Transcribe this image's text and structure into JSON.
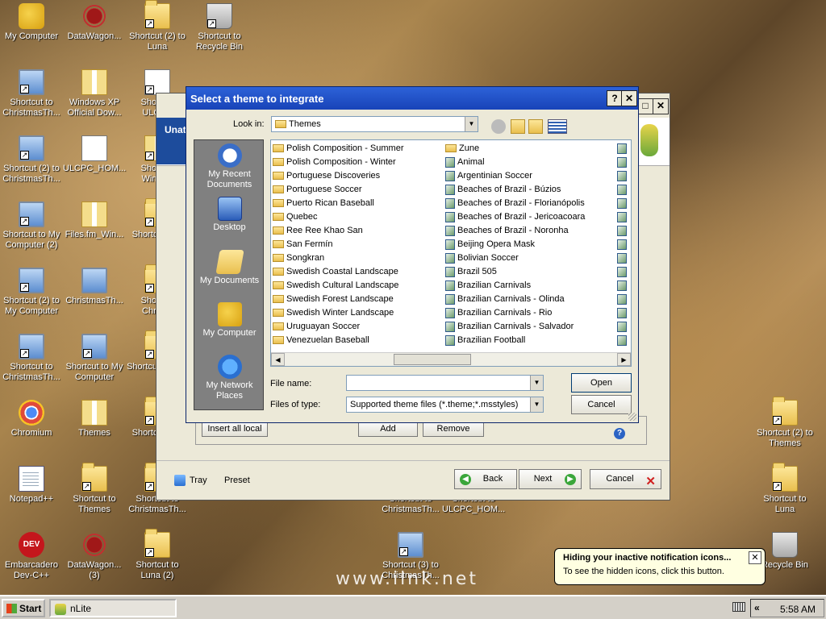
{
  "desktop": {
    "icons": [
      {
        "id": "my-computer",
        "label": "My Computer",
        "icon": "puzzle-icon"
      },
      {
        "id": "datawagon-1",
        "label": "DataWagon...",
        "icon": "web-icon"
      },
      {
        "id": "shortcut-luna-2",
        "label": "Shortcut (2) to Luna",
        "icon": "folder-icon"
      },
      {
        "id": "shortcut-recycle",
        "label": "Shortcut to Recycle Bin",
        "icon": "recycle-bin-icon"
      },
      {
        "id": "shortcut-christmas-1",
        "label": "Shortcut to ChristmasTh...",
        "icon": "pc-icon"
      },
      {
        "id": "winxp-official",
        "label": "Windows XP Official Dow...",
        "icon": "zip-icon"
      },
      {
        "id": "shortcut-ulcpc",
        "label": "Shortcut ULCPC",
        "icon": "doc-icon"
      },
      {
        "id": "shortcut-christmas-2",
        "label": "Shortcut (2) to ChristmasTh...",
        "icon": "pc-icon"
      },
      {
        "id": "ulcpc-hom",
        "label": "ULCPC_HOM...",
        "icon": "doc-icon"
      },
      {
        "id": "shortcut-window",
        "label": "Shortcut Window",
        "icon": "zip-icon"
      },
      {
        "id": "shortcut-mycomp-2",
        "label": "Shortcut to My Computer (2)",
        "icon": "pc-icon"
      },
      {
        "id": "files-fm",
        "label": "Files.fm_Win...",
        "icon": "zip-icon"
      },
      {
        "id": "shortcut-the",
        "label": "Shortcut The",
        "icon": "folder-icon"
      },
      {
        "id": "shortcut2-mycomp",
        "label": "Shortcut (2) to My Computer",
        "icon": "pc-icon"
      },
      {
        "id": "christmasth",
        "label": "ChristmasTh...",
        "icon": "pc-icon"
      },
      {
        "id": "shortcut-christm",
        "label": "Shortcut Christm",
        "icon": "folder-icon"
      },
      {
        "id": "shortcut-christmas-3",
        "label": "Shortcut to ChristmasTh...",
        "icon": "pc-icon"
      },
      {
        "id": "shortcut-mycomp",
        "label": "Shortcut to My Computer",
        "icon": "pc-icon"
      },
      {
        "id": "shortcut-myco",
        "label": "Shortcut My Co",
        "icon": "folder-icon"
      },
      {
        "id": "chromium",
        "label": "Chromium",
        "icon": "chromium-icon"
      },
      {
        "id": "themes",
        "label": "Themes",
        "icon": "zip-icon"
      },
      {
        "id": "shortcut-the-2",
        "label": "Shortcut The",
        "icon": "folder-icon"
      },
      {
        "id": "notepadpp",
        "label": "Notepad++",
        "icon": "notepad-icon"
      },
      {
        "id": "shortcut-themes",
        "label": "Shortcut to Themes",
        "icon": "folder-icon"
      },
      {
        "id": "shortcut-christmas-4",
        "label": "Shortcut to ChristmasTh...",
        "icon": "folder-icon"
      },
      {
        "id": "embarcadero",
        "label": "Embarcadero Dev-C++",
        "icon": "devcpp-icon"
      },
      {
        "id": "datawagon-3",
        "label": "DataWagon... (3)",
        "icon": "web-icon"
      },
      {
        "id": "shortcut-luna-2b",
        "label": "Shortcut to Luna (2)",
        "icon": "folder-icon"
      },
      {
        "id": "shortcut-christmas-mid",
        "label": "Shortcut to ChristmasTh...",
        "icon": "folder-icon"
      },
      {
        "id": "shortcut-ulcpc-hom",
        "label": "Shortcut to ULCPC_HOM...",
        "icon": "folder-icon"
      },
      {
        "id": "shortcut3-christmas",
        "label": "Shortcut (3) to ChristmasTh...",
        "icon": "pc-icon"
      },
      {
        "id": "shortcut2-themes",
        "label": "Shortcut (2) to Themes",
        "icon": "folder-icon"
      },
      {
        "id": "shortcut-luna",
        "label": "Shortcut to Luna",
        "icon": "folder-icon"
      },
      {
        "id": "recycle-bin",
        "label": "Recycle Bin",
        "icon": "recycle-bin-icon"
      }
    ],
    "watermark": "www.ilnk.net"
  },
  "nlite": {
    "header_text": "Unat",
    "buttons": {
      "insert_all_local": "Insert all local",
      "add": "Add",
      "remove": "Remove",
      "tray": "Tray",
      "preset": "Preset",
      "back": "Back",
      "next": "Next",
      "cancel": "Cancel"
    }
  },
  "dialog": {
    "title": "Select a theme to integrate",
    "help_btn": "?",
    "close_btn": "✕",
    "look_in_label": "Look in:",
    "look_in_value": "Themes",
    "places": [
      {
        "label": "My Recent Documents",
        "icon": "recent-documents-icon"
      },
      {
        "label": "Desktop",
        "icon": "desktop-icon"
      },
      {
        "label": "My Documents",
        "icon": "my-documents-icon"
      },
      {
        "label": "My Computer",
        "icon": "my-computer-icon"
      },
      {
        "label": "My Network Places",
        "icon": "network-places-icon"
      }
    ],
    "files_col1": [
      "Polish Composition - Summer",
      "Polish Composition - Winter",
      "Portuguese Discoveries",
      "Portuguese Soccer",
      "Puerto Rican Baseball",
      "Quebec",
      "Ree Ree Khao San",
      "San Fermín",
      "Songkran",
      "Swedish Coastal Landscape",
      "Swedish Cultural Landscape",
      "Swedish Forest Landscape",
      "Swedish Winter Landscape",
      "Uruguayan Soccer",
      "Venezuelan Baseball"
    ],
    "files_col2": [
      {
        "name": "Zune",
        "type": "folder"
      },
      {
        "name": "Animal",
        "type": "theme"
      },
      {
        "name": "Argentinian Soccer",
        "type": "theme"
      },
      {
        "name": "Beaches of Brazil - Búzios",
        "type": "theme"
      },
      {
        "name": "Beaches of Brazil - Florianópolis",
        "type": "theme"
      },
      {
        "name": "Beaches of Brazil - Jericoacoara",
        "type": "theme"
      },
      {
        "name": "Beaches of Brazil - Noronha",
        "type": "theme"
      },
      {
        "name": "Beijing Opera Mask",
        "type": "theme"
      },
      {
        "name": "Bolivian Soccer",
        "type": "theme"
      },
      {
        "name": "Brazil 505",
        "type": "theme"
      },
      {
        "name": "Brazilian Carnivals",
        "type": "theme"
      },
      {
        "name": "Brazilian Carnivals - Olinda",
        "type": "theme"
      },
      {
        "name": "Brazilian Carnivals - Rio",
        "type": "theme"
      },
      {
        "name": "Brazilian Carnivals - Salvador",
        "type": "theme"
      },
      {
        "name": "Brazilian Football",
        "type": "theme"
      }
    ],
    "file_name_label": "File name:",
    "file_name_value": "",
    "files_of_type_label": "Files of type:",
    "files_of_type_value": "Supported theme files (*.theme;*.msstyles)",
    "open_btn": "Open",
    "cancel_btn": "Cancel"
  },
  "taskbar": {
    "start_label": "Start",
    "task_label": "nLite",
    "clock": "5:58 AM"
  },
  "balloon": {
    "title": "Hiding your inactive notification icons...",
    "body": "To see the hidden icons, click this button.",
    "close": "✕"
  }
}
